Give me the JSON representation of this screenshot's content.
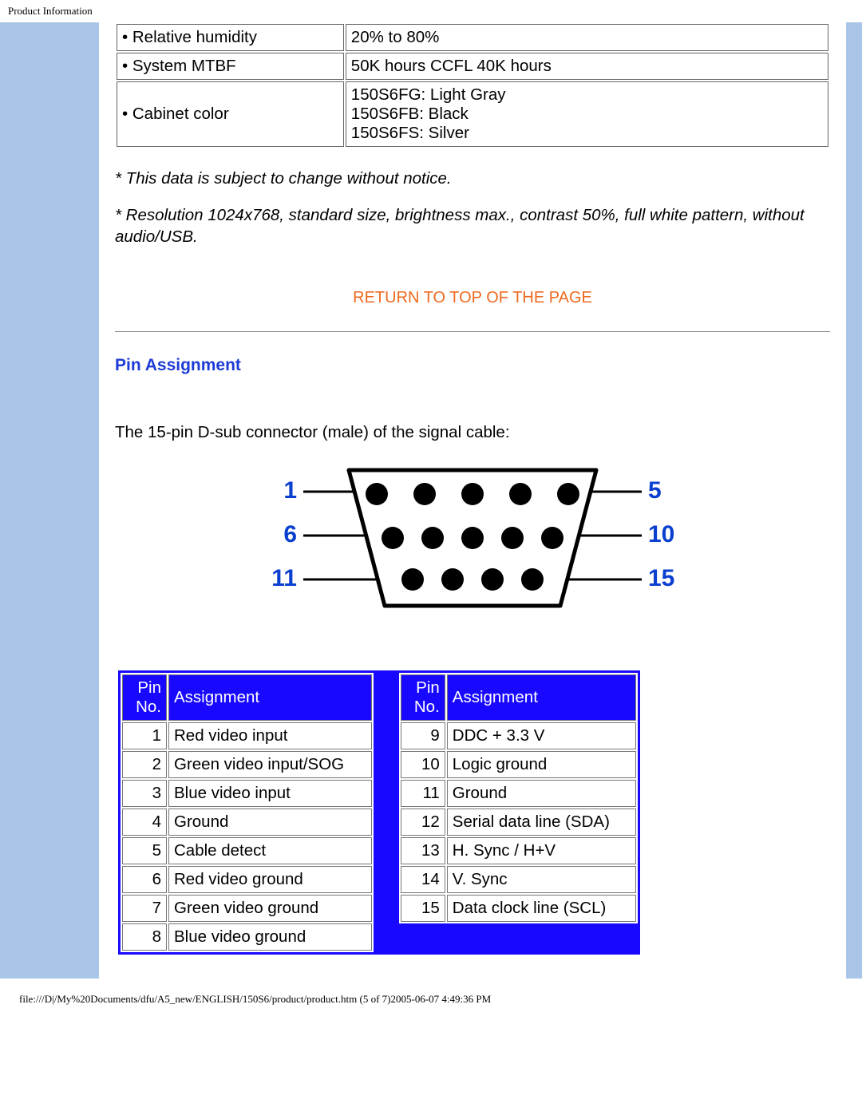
{
  "header": {
    "title": "Product Information"
  },
  "spec_rows": [
    {
      "label": "• Relative humidity",
      "value": "20% to 80%"
    },
    {
      "label": "• System MTBF",
      "value": "50K hours CCFL 40K hours"
    },
    {
      "label": "• Cabinet color",
      "value": "150S6FG: Light Gray\n150S6FB: Black\n150S6FS: Silver"
    }
  ],
  "notes": {
    "line1": "* This data is subject to change without notice.",
    "line2": "* Resolution 1024x768, standard size, brightness max., contrast 50%, full white pattern, without audio/USB."
  },
  "top_link": {
    "label": "RETURN TO TOP OF THE PAGE"
  },
  "section": {
    "title": "Pin Assignment",
    "desc": "The 15-pin D-sub connector (male) of the signal cable:"
  },
  "diagram": {
    "left_labels": [
      "1",
      "6",
      "11"
    ],
    "right_labels": [
      "5",
      "10",
      "15"
    ]
  },
  "pin_table": {
    "headers": {
      "pin": "Pin No.",
      "assign": "Assignment"
    },
    "left": [
      {
        "n": "1",
        "a": "Red video input"
      },
      {
        "n": "2",
        "a": "Green video input/SOG"
      },
      {
        "n": "3",
        "a": "Blue video input"
      },
      {
        "n": "4",
        "a": "Ground"
      },
      {
        "n": "5",
        "a": "Cable detect"
      },
      {
        "n": "6",
        "a": "Red video ground"
      },
      {
        "n": "7",
        "a": "Green video ground"
      },
      {
        "n": "8",
        "a": "Blue video ground"
      }
    ],
    "right": [
      {
        "n": "9",
        "a": "DDC + 3.3 V"
      },
      {
        "n": "10",
        "a": "Logic ground"
      },
      {
        "n": "11",
        "a": "Ground"
      },
      {
        "n": "12",
        "a": "Serial data line (SDA)"
      },
      {
        "n": "13",
        "a": "H. Sync / H+V"
      },
      {
        "n": "14",
        "a": "V. Sync"
      },
      {
        "n": "15",
        "a": "Data clock line (SCL)"
      }
    ]
  },
  "footer": {
    "path": "file:///D|/My%20Documents/dfu/A5_new/ENGLISH/150S6/product/product.htm (5 of 7)2005-06-07 4:49:36 PM"
  }
}
